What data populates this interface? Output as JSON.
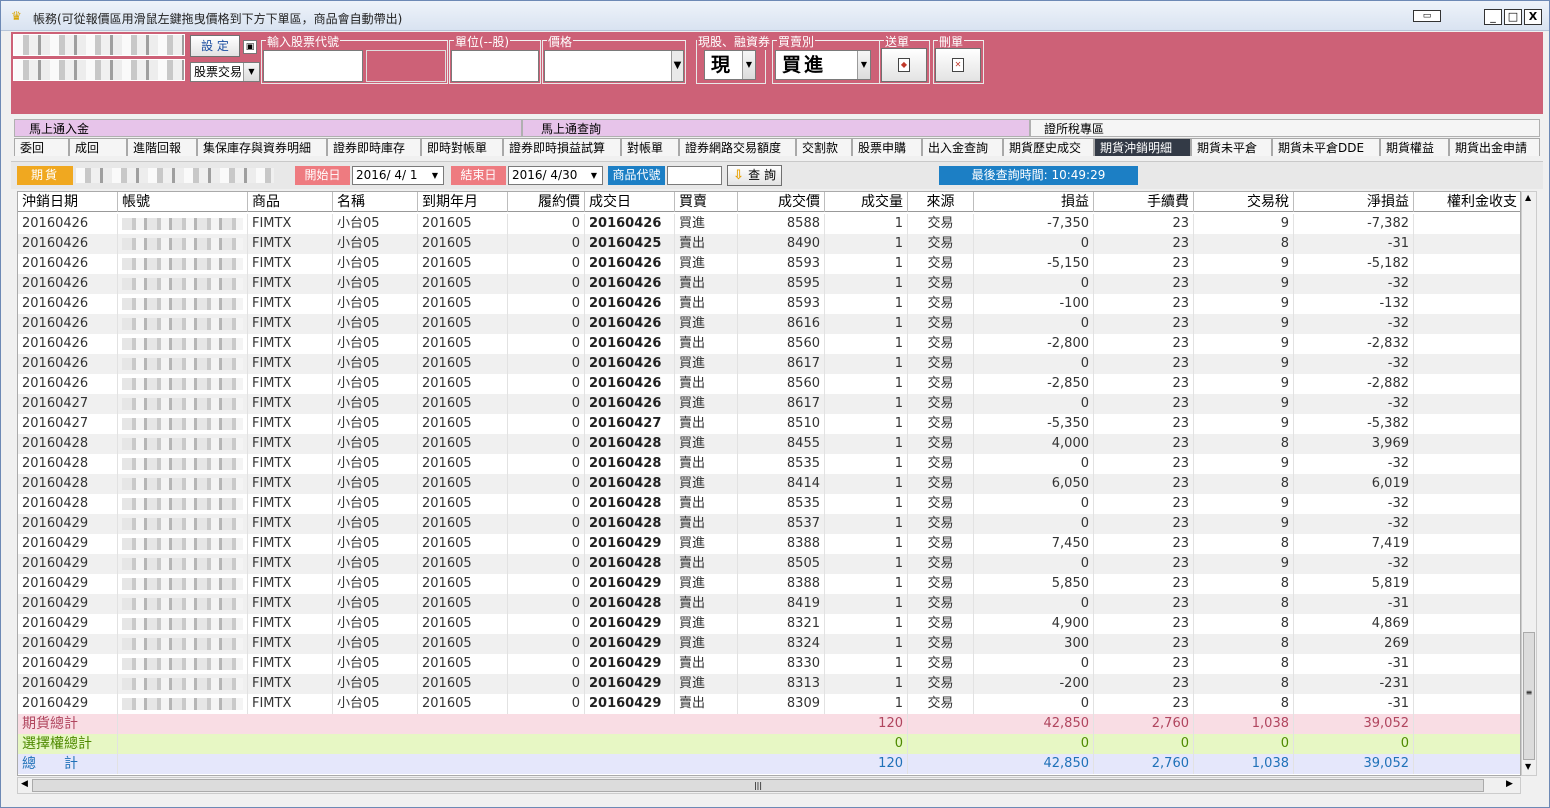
{
  "window": {
    "title": "帳務(可從報價區用滑鼠左鍵拖曳價格到下方下單區，商品會自動帶出)",
    "minimize": "_",
    "maximize": "□",
    "close": "X"
  },
  "order_panel": {
    "settings_button": "設 定",
    "trade_type": "股票交易",
    "stock_code_label": "輸入股票代號",
    "unit_label": "單位(--股)",
    "price_label": "價格",
    "cash_margin_label": "現股、融資券",
    "cash_margin_value": "現",
    "buy_sell_label": "買賣別",
    "buy_sell_value": "買進",
    "send_label": "送單",
    "delete_label": "刪單"
  },
  "upper_tabs": [
    "馬上通入金",
    "馬上通查詢",
    "證所稅專區"
  ],
  "tabs": [
    "委回",
    "成回",
    "進階回報",
    "集保庫存與資券明細",
    "證券即時庫存",
    "即時對帳單",
    "證券即時損益試算",
    "對帳單",
    "證券網路交易額度",
    "交割款",
    "股票申購",
    "出入金查詢",
    "期貨歷史成交",
    "期貨沖銷明細",
    "期貨未平倉",
    "期貨未平倉DDE",
    "期貨權益",
    "期貨出金申請"
  ],
  "active_tab": "期貨沖銷明細",
  "query_bar": {
    "market_label": "期貨",
    "start_label": "開始日",
    "start_date": "2016/ 4/ 1",
    "end_label": "結束日",
    "end_date": "2016/ 4/30",
    "product_code_label": "商品代號",
    "query_button": "查 詢",
    "last_query": "最後查詢時間: 10:49:29"
  },
  "columns": [
    "沖銷日期",
    "帳號",
    "商品",
    "名稱",
    "到期年月",
    "履約價",
    "成交日",
    "買賣",
    "成交價",
    "成交量",
    "來源",
    "損益",
    "手續費",
    "交易稅",
    "淨損益",
    "權利金收支"
  ],
  "rows": [
    [
      "20160426",
      "FIMTX",
      "小台05",
      "201605",
      "0",
      "20160426",
      "買進",
      "8588",
      "1",
      "交易",
      "-7,350",
      "23",
      "9",
      "-7,382"
    ],
    [
      "20160426",
      "FIMTX",
      "小台05",
      "201605",
      "0",
      "20160425",
      "賣出",
      "8490",
      "1",
      "交易",
      "0",
      "23",
      "8",
      "-31"
    ],
    [
      "20160426",
      "FIMTX",
      "小台05",
      "201605",
      "0",
      "20160426",
      "買進",
      "8593",
      "1",
      "交易",
      "-5,150",
      "23",
      "9",
      "-5,182"
    ],
    [
      "20160426",
      "FIMTX",
      "小台05",
      "201605",
      "0",
      "20160426",
      "賣出",
      "8595",
      "1",
      "交易",
      "0",
      "23",
      "9",
      "-32"
    ],
    [
      "20160426",
      "FIMTX",
      "小台05",
      "201605",
      "0",
      "20160426",
      "賣出",
      "8593",
      "1",
      "交易",
      "-100",
      "23",
      "9",
      "-132"
    ],
    [
      "20160426",
      "FIMTX",
      "小台05",
      "201605",
      "0",
      "20160426",
      "買進",
      "8616",
      "1",
      "交易",
      "0",
      "23",
      "9",
      "-32"
    ],
    [
      "20160426",
      "FIMTX",
      "小台05",
      "201605",
      "0",
      "20160426",
      "賣出",
      "8560",
      "1",
      "交易",
      "-2,800",
      "23",
      "9",
      "-2,832"
    ],
    [
      "20160426",
      "FIMTX",
      "小台05",
      "201605",
      "0",
      "20160426",
      "買進",
      "8617",
      "1",
      "交易",
      "0",
      "23",
      "9",
      "-32"
    ],
    [
      "20160426",
      "FIMTX",
      "小台05",
      "201605",
      "0",
      "20160426",
      "賣出",
      "8560",
      "1",
      "交易",
      "-2,850",
      "23",
      "9",
      "-2,882"
    ],
    [
      "20160427",
      "FIMTX",
      "小台05",
      "201605",
      "0",
      "20160426",
      "買進",
      "8617",
      "1",
      "交易",
      "0",
      "23",
      "9",
      "-32"
    ],
    [
      "20160427",
      "FIMTX",
      "小台05",
      "201605",
      "0",
      "20160427",
      "賣出",
      "8510",
      "1",
      "交易",
      "-5,350",
      "23",
      "9",
      "-5,382"
    ],
    [
      "20160428",
      "FIMTX",
      "小台05",
      "201605",
      "0",
      "20160428",
      "買進",
      "8455",
      "1",
      "交易",
      "4,000",
      "23",
      "8",
      "3,969"
    ],
    [
      "20160428",
      "FIMTX",
      "小台05",
      "201605",
      "0",
      "20160428",
      "賣出",
      "8535",
      "1",
      "交易",
      "0",
      "23",
      "9",
      "-32"
    ],
    [
      "20160428",
      "FIMTX",
      "小台05",
      "201605",
      "0",
      "20160428",
      "買進",
      "8414",
      "1",
      "交易",
      "6,050",
      "23",
      "8",
      "6,019"
    ],
    [
      "20160428",
      "FIMTX",
      "小台05",
      "201605",
      "0",
      "20160428",
      "賣出",
      "8535",
      "1",
      "交易",
      "0",
      "23",
      "9",
      "-32"
    ],
    [
      "20160429",
      "FIMTX",
      "小台05",
      "201605",
      "0",
      "20160428",
      "賣出",
      "8537",
      "1",
      "交易",
      "0",
      "23",
      "9",
      "-32"
    ],
    [
      "20160429",
      "FIMTX",
      "小台05",
      "201605",
      "0",
      "20160429",
      "買進",
      "8388",
      "1",
      "交易",
      "7,450",
      "23",
      "8",
      "7,419"
    ],
    [
      "20160429",
      "FIMTX",
      "小台05",
      "201605",
      "0",
      "20160428",
      "賣出",
      "8505",
      "1",
      "交易",
      "0",
      "23",
      "9",
      "-32"
    ],
    [
      "20160429",
      "FIMTX",
      "小台05",
      "201605",
      "0",
      "20160429",
      "買進",
      "8388",
      "1",
      "交易",
      "5,850",
      "23",
      "8",
      "5,819"
    ],
    [
      "20160429",
      "FIMTX",
      "小台05",
      "201605",
      "0",
      "20160428",
      "賣出",
      "8419",
      "1",
      "交易",
      "0",
      "23",
      "8",
      "-31"
    ],
    [
      "20160429",
      "FIMTX",
      "小台05",
      "201605",
      "0",
      "20160429",
      "買進",
      "8321",
      "1",
      "交易",
      "4,900",
      "23",
      "8",
      "4,869"
    ],
    [
      "20160429",
      "FIMTX",
      "小台05",
      "201605",
      "0",
      "20160429",
      "買進",
      "8324",
      "1",
      "交易",
      "300",
      "23",
      "8",
      "269"
    ],
    [
      "20160429",
      "FIMTX",
      "小台05",
      "201605",
      "0",
      "20160429",
      "賣出",
      "8330",
      "1",
      "交易",
      "0",
      "23",
      "8",
      "-31"
    ],
    [
      "20160429",
      "FIMTX",
      "小台05",
      "201605",
      "0",
      "20160429",
      "買進",
      "8313",
      "1",
      "交易",
      "-200",
      "23",
      "8",
      "-231"
    ],
    [
      "20160429",
      "FIMTX",
      "小台05",
      "201605",
      "0",
      "20160429",
      "賣出",
      "8309",
      "1",
      "交易",
      "0",
      "23",
      "8",
      "-31"
    ]
  ],
  "totals": [
    {
      "label": "期貨總計",
      "qty": "120",
      "pl": "42,850",
      "fee": "2,760",
      "tax": "1,038",
      "net": "39,052",
      "color": "#b0455e",
      "bg": "#f9dde4"
    },
    {
      "label": "選擇權總計",
      "qty": "0",
      "pl": "0",
      "fee": "0",
      "tax": "0",
      "net": "0",
      "color": "#4e8a00",
      "bg": "#e7f7c4"
    },
    {
      "label": "總　　計",
      "qty": "120",
      "pl": "42,850",
      "fee": "2,760",
      "tax": "1,038",
      "net": "39,052",
      "color": "#1f71b8",
      "bg": "#e5e7fb"
    }
  ],
  "colors": {
    "panel": "#cd6177",
    "active_tab": "#333a46",
    "status_blue": "#1c7fc5",
    "label_orange": "#f0a820",
    "label_red": "#ee7b80"
  }
}
